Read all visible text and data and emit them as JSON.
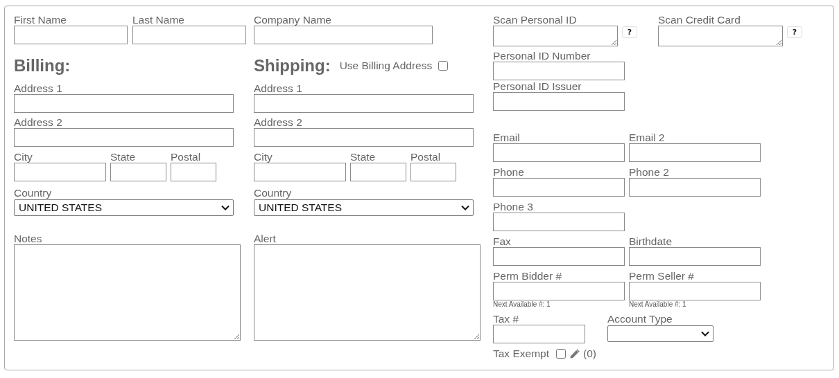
{
  "name_fields": [
    {
      "label": "First Name"
    },
    {
      "label": "Last Name"
    },
    {
      "label": "Company Name"
    }
  ],
  "billing": {
    "heading": "Billing:",
    "fields": [
      {
        "label": "Address 1",
        "kind": "text"
      },
      {
        "label": "Address 2",
        "kind": "text"
      },
      {
        "label": "City",
        "kind": "text"
      },
      {
        "label": "State",
        "kind": "text"
      },
      {
        "label": "Postal",
        "kind": "text"
      },
      {
        "label": "Country",
        "kind": "select",
        "value": "UNITED STATES"
      }
    ]
  },
  "shipping": {
    "heading": "Shipping:",
    "use_billing_address": {
      "label": "Use Billing Address",
      "checked": false
    },
    "fields": [
      {
        "label": "Address 1",
        "kind": "text"
      },
      {
        "label": "Address 2",
        "kind": "text"
      },
      {
        "label": "City",
        "kind": "text"
      },
      {
        "label": "State",
        "kind": "text"
      },
      {
        "label": "Postal",
        "kind": "text"
      },
      {
        "label": "Country",
        "kind": "select",
        "value": "UNITED STATES"
      }
    ]
  },
  "notes": {
    "label": "Notes"
  },
  "alert": {
    "label": "Alert"
  },
  "scan_fields": [
    {
      "label": "Scan Personal ID",
      "help": "?"
    },
    {
      "label": "Scan Credit Card",
      "help": "?"
    }
  ],
  "id_fields": [
    {
      "label": "Personal ID Number"
    },
    {
      "label": "Personal ID Issuer"
    }
  ],
  "contact_rows": [
    [
      {
        "label": "Email"
      },
      {
        "label": "Email 2"
      }
    ],
    [
      {
        "label": "Phone"
      },
      {
        "label": "Phone 2"
      }
    ],
    [
      {
        "label": "Phone 3"
      }
    ],
    [
      {
        "label": "Fax"
      },
      {
        "label": "Birthdate"
      }
    ],
    [
      {
        "label": "Perm Bidder #",
        "hint": "Next Available #: 1"
      },
      {
        "label": "Perm Seller #",
        "hint": "Next Available #: 1"
      }
    ]
  ],
  "tax_number": {
    "label": "Tax #"
  },
  "account_type": {
    "label": "Account Type"
  },
  "tax_exempt": {
    "label": "Tax Exempt",
    "checked": false,
    "count": "(0)"
  }
}
